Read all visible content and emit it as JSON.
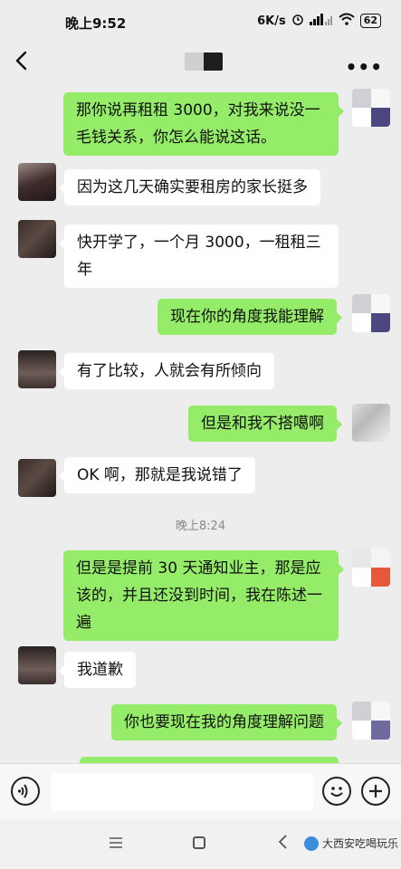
{
  "status_bar": {
    "time": "晚上9:52",
    "network_speed": "6K/s",
    "battery": "62"
  },
  "header": {
    "back_icon": "chevron-left-icon",
    "more_label": "•••"
  },
  "messages": [
    {
      "side": "out",
      "text": "那你说再租租 3000，对我来说没一毛钱关系，你怎么能说这话。"
    },
    {
      "side": "in",
      "text": "因为这几天确实要租房的家长挺多"
    },
    {
      "side": "in",
      "text": "快开学了，一个月 3000，一租租三年"
    },
    {
      "side": "out",
      "text": "现在你的角度我能理解"
    },
    {
      "side": "in",
      "text": "有了比较，人就会有所倾向"
    },
    {
      "side": "out",
      "text": "但是和我不搭噶啊"
    },
    {
      "side": "in",
      "text": "OK 啊，那就是我说错了"
    },
    {
      "side": "out",
      "text": "但是是提前 30 天通知业主，那是应该的，并且还没到时间，我在陈述一遍"
    },
    {
      "side": "in",
      "text": "我道歉"
    },
    {
      "side": "out",
      "text": "你也要现在我的角度理解问题"
    }
  ],
  "time_separator": "晚上8:24",
  "input_bar": {
    "value": ""
  },
  "watermark": "大西安吃喝玩乐",
  "colors": {
    "outgoing_bubble": "#95ec69",
    "incoming_bubble": "#ffffff",
    "background": "#ededed"
  }
}
